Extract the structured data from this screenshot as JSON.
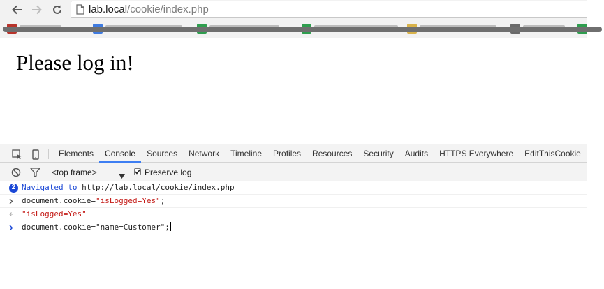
{
  "browser": {
    "url_host": "lab.local",
    "url_path": "/cookie/index.php",
    "icons": {
      "back": "back-arrow-icon",
      "forward": "forward-arrow-icon",
      "reload": "reload-icon",
      "page": "page-icon"
    }
  },
  "page": {
    "heading": "Please log in!"
  },
  "devtools": {
    "tabs": [
      "Elements",
      "Console",
      "Sources",
      "Network",
      "Timeline",
      "Profiles",
      "Resources",
      "Security",
      "Audits",
      "HTTPS Everywhere",
      "EditThisCookie"
    ],
    "active_tab": "Console",
    "frame_select": "<top frame>",
    "preserve_log_label": "Preserve log",
    "preserve_log_checked": true,
    "accent_color": "#3d7ef2",
    "console": {
      "navigated_count": "2",
      "navigated_text": "Navigated to",
      "navigated_url": "http://lab.local/cookie/index.php",
      "command1_prefix": "document.cookie=",
      "command1_value": "\"isLogged=Yes\"",
      "command1_suffix": ";",
      "result1": "\"isLogged=Yes\"",
      "command2": "document.cookie=\"name=Customer\";"
    }
  }
}
